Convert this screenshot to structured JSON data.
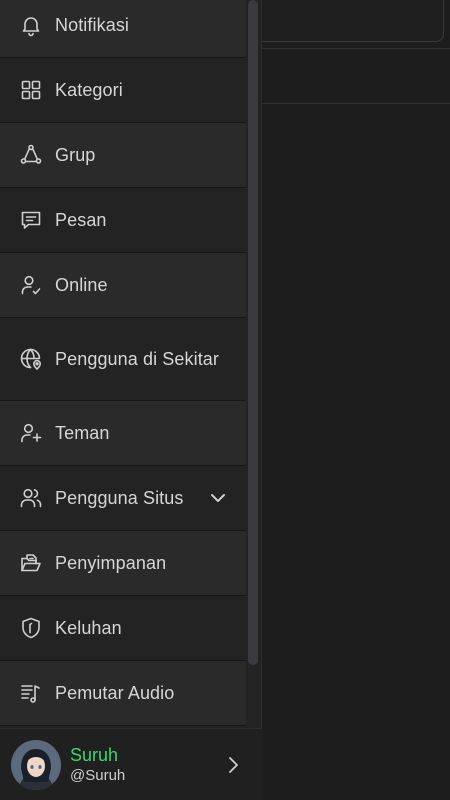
{
  "drawer": {
    "items": [
      {
        "label": "Notifikasi",
        "icon": "bell-icon"
      },
      {
        "label": "Kategori",
        "icon": "grid-icon"
      },
      {
        "label": "Grup",
        "icon": "group-share-icon"
      },
      {
        "label": "Pesan",
        "icon": "message-icon"
      },
      {
        "label": "Online",
        "icon": "user-check-icon"
      },
      {
        "label": "Pengguna di Sekitar",
        "icon": "globe-location-icon"
      },
      {
        "label": "Teman",
        "icon": "user-plus-icon"
      },
      {
        "label": "Pengguna Situs",
        "icon": "users-icon",
        "expandable": true
      },
      {
        "label": "Penyimpanan",
        "icon": "folder-icon"
      },
      {
        "label": "Keluhan",
        "icon": "shield-icon"
      },
      {
        "label": "Pemutar Audio",
        "icon": "playlist-music-icon"
      }
    ]
  },
  "profile": {
    "name": "Suruh",
    "handle": "@Suruh"
  },
  "colors": {
    "drawer_bg": "#232323",
    "item_alt_bg": "#2a2a2a",
    "accent_green": "#3fd56d",
    "text": "#d6d6d6"
  }
}
